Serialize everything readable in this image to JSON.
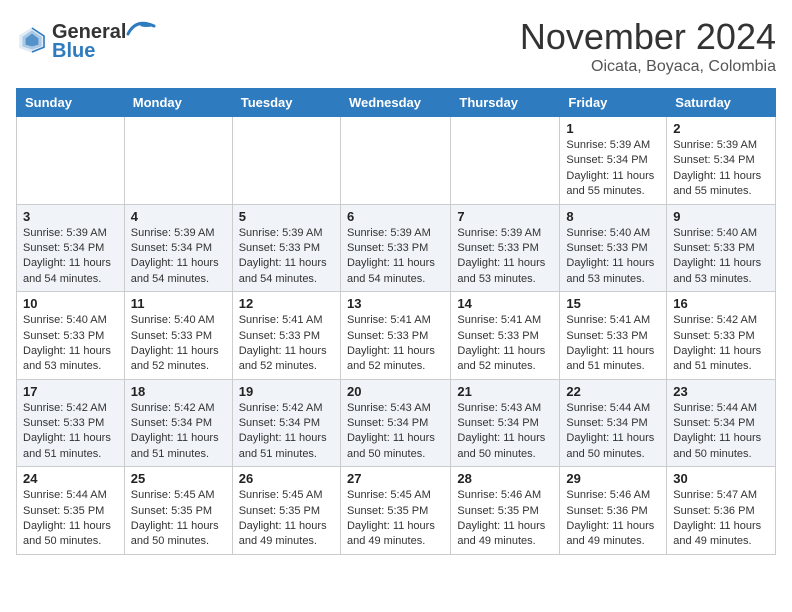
{
  "header": {
    "logo_line1": "General",
    "logo_line2": "Blue",
    "month": "November 2024",
    "location": "Oicata, Boyaca, Colombia"
  },
  "weekdays": [
    "Sunday",
    "Monday",
    "Tuesday",
    "Wednesday",
    "Thursday",
    "Friday",
    "Saturday"
  ],
  "weeks": [
    [
      {
        "day": "",
        "info": ""
      },
      {
        "day": "",
        "info": ""
      },
      {
        "day": "",
        "info": ""
      },
      {
        "day": "",
        "info": ""
      },
      {
        "day": "",
        "info": ""
      },
      {
        "day": "1",
        "info": "Sunrise: 5:39 AM\nSunset: 5:34 PM\nDaylight: 11 hours and 55 minutes."
      },
      {
        "day": "2",
        "info": "Sunrise: 5:39 AM\nSunset: 5:34 PM\nDaylight: 11 hours and 55 minutes."
      }
    ],
    [
      {
        "day": "3",
        "info": "Sunrise: 5:39 AM\nSunset: 5:34 PM\nDaylight: 11 hours and 54 minutes."
      },
      {
        "day": "4",
        "info": "Sunrise: 5:39 AM\nSunset: 5:34 PM\nDaylight: 11 hours and 54 minutes."
      },
      {
        "day": "5",
        "info": "Sunrise: 5:39 AM\nSunset: 5:33 PM\nDaylight: 11 hours and 54 minutes."
      },
      {
        "day": "6",
        "info": "Sunrise: 5:39 AM\nSunset: 5:33 PM\nDaylight: 11 hours and 54 minutes."
      },
      {
        "day": "7",
        "info": "Sunrise: 5:39 AM\nSunset: 5:33 PM\nDaylight: 11 hours and 53 minutes."
      },
      {
        "day": "8",
        "info": "Sunrise: 5:40 AM\nSunset: 5:33 PM\nDaylight: 11 hours and 53 minutes."
      },
      {
        "day": "9",
        "info": "Sunrise: 5:40 AM\nSunset: 5:33 PM\nDaylight: 11 hours and 53 minutes."
      }
    ],
    [
      {
        "day": "10",
        "info": "Sunrise: 5:40 AM\nSunset: 5:33 PM\nDaylight: 11 hours and 53 minutes."
      },
      {
        "day": "11",
        "info": "Sunrise: 5:40 AM\nSunset: 5:33 PM\nDaylight: 11 hours and 52 minutes."
      },
      {
        "day": "12",
        "info": "Sunrise: 5:41 AM\nSunset: 5:33 PM\nDaylight: 11 hours and 52 minutes."
      },
      {
        "day": "13",
        "info": "Sunrise: 5:41 AM\nSunset: 5:33 PM\nDaylight: 11 hours and 52 minutes."
      },
      {
        "day": "14",
        "info": "Sunrise: 5:41 AM\nSunset: 5:33 PM\nDaylight: 11 hours and 52 minutes."
      },
      {
        "day": "15",
        "info": "Sunrise: 5:41 AM\nSunset: 5:33 PM\nDaylight: 11 hours and 51 minutes."
      },
      {
        "day": "16",
        "info": "Sunrise: 5:42 AM\nSunset: 5:33 PM\nDaylight: 11 hours and 51 minutes."
      }
    ],
    [
      {
        "day": "17",
        "info": "Sunrise: 5:42 AM\nSunset: 5:33 PM\nDaylight: 11 hours and 51 minutes."
      },
      {
        "day": "18",
        "info": "Sunrise: 5:42 AM\nSunset: 5:34 PM\nDaylight: 11 hours and 51 minutes."
      },
      {
        "day": "19",
        "info": "Sunrise: 5:42 AM\nSunset: 5:34 PM\nDaylight: 11 hours and 51 minutes."
      },
      {
        "day": "20",
        "info": "Sunrise: 5:43 AM\nSunset: 5:34 PM\nDaylight: 11 hours and 50 minutes."
      },
      {
        "day": "21",
        "info": "Sunrise: 5:43 AM\nSunset: 5:34 PM\nDaylight: 11 hours and 50 minutes."
      },
      {
        "day": "22",
        "info": "Sunrise: 5:44 AM\nSunset: 5:34 PM\nDaylight: 11 hours and 50 minutes."
      },
      {
        "day": "23",
        "info": "Sunrise: 5:44 AM\nSunset: 5:34 PM\nDaylight: 11 hours and 50 minutes."
      }
    ],
    [
      {
        "day": "24",
        "info": "Sunrise: 5:44 AM\nSunset: 5:35 PM\nDaylight: 11 hours and 50 minutes."
      },
      {
        "day": "25",
        "info": "Sunrise: 5:45 AM\nSunset: 5:35 PM\nDaylight: 11 hours and 50 minutes."
      },
      {
        "day": "26",
        "info": "Sunrise: 5:45 AM\nSunset: 5:35 PM\nDaylight: 11 hours and 49 minutes."
      },
      {
        "day": "27",
        "info": "Sunrise: 5:45 AM\nSunset: 5:35 PM\nDaylight: 11 hours and 49 minutes."
      },
      {
        "day": "28",
        "info": "Sunrise: 5:46 AM\nSunset: 5:35 PM\nDaylight: 11 hours and 49 minutes."
      },
      {
        "day": "29",
        "info": "Sunrise: 5:46 AM\nSunset: 5:36 PM\nDaylight: 11 hours and 49 minutes."
      },
      {
        "day": "30",
        "info": "Sunrise: 5:47 AM\nSunset: 5:36 PM\nDaylight: 11 hours and 49 minutes."
      }
    ]
  ]
}
